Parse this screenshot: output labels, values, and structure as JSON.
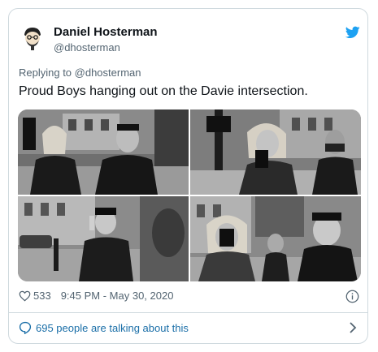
{
  "author": {
    "name": "Daniel Hosterman",
    "handle": "@dhosterman"
  },
  "reply": {
    "label": "Replying to @dhosterman"
  },
  "tweet": {
    "text": "Proud Boys hanging out on the Davie intersection."
  },
  "meta": {
    "likes": "533",
    "timestamp": "9:45 PM - May 30, 2020"
  },
  "footer": {
    "talking": "695 people are talking about this"
  },
  "icons": {
    "brand": "twitter-bird-icon",
    "like": "heart-icon",
    "info": "info-icon",
    "conversation": "speech-bubble-icon",
    "more": "chevron-right-icon"
  },
  "colors": {
    "brand": "#1da1f2",
    "link": "#1b6fa8",
    "muted": "#536471",
    "border": "#cfd9de"
  }
}
